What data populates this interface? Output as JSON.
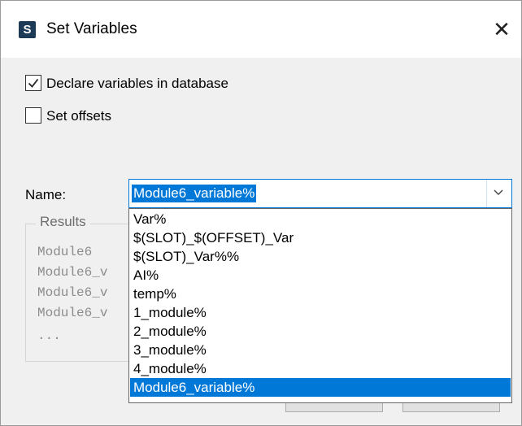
{
  "window": {
    "title": "Set Variables",
    "app_icon_letter": "S",
    "close_glyph": "✕"
  },
  "options": {
    "declare_label": "Declare variables in database",
    "declare_checked": true,
    "offsets_label": "Set offsets",
    "offsets_checked": false
  },
  "name_field": {
    "label": "Name:",
    "value": "Module6_variable%"
  },
  "results": {
    "title": "Results",
    "lines": [
      "Module6",
      "Module6_v",
      "Module6_v",
      "Module6_v",
      "..."
    ]
  },
  "dropdown": {
    "options": [
      "Var%",
      "$(SLOT)_$(OFFSET)_Var",
      "$(SLOT)_Var%%",
      "AI%",
      "temp%",
      "1_module%",
      "2_module%",
      "3_module%",
      "4_module%",
      "Module6_variable%"
    ],
    "selected_index": 9
  },
  "colors": {
    "accent": "#0078d7",
    "dialog_bg": "#f0f0f0"
  },
  "icons": {
    "app": "app-logo-icon",
    "close": "close-icon",
    "checkmark": "checkmark-icon",
    "dropdown": "chevron-down-icon"
  }
}
